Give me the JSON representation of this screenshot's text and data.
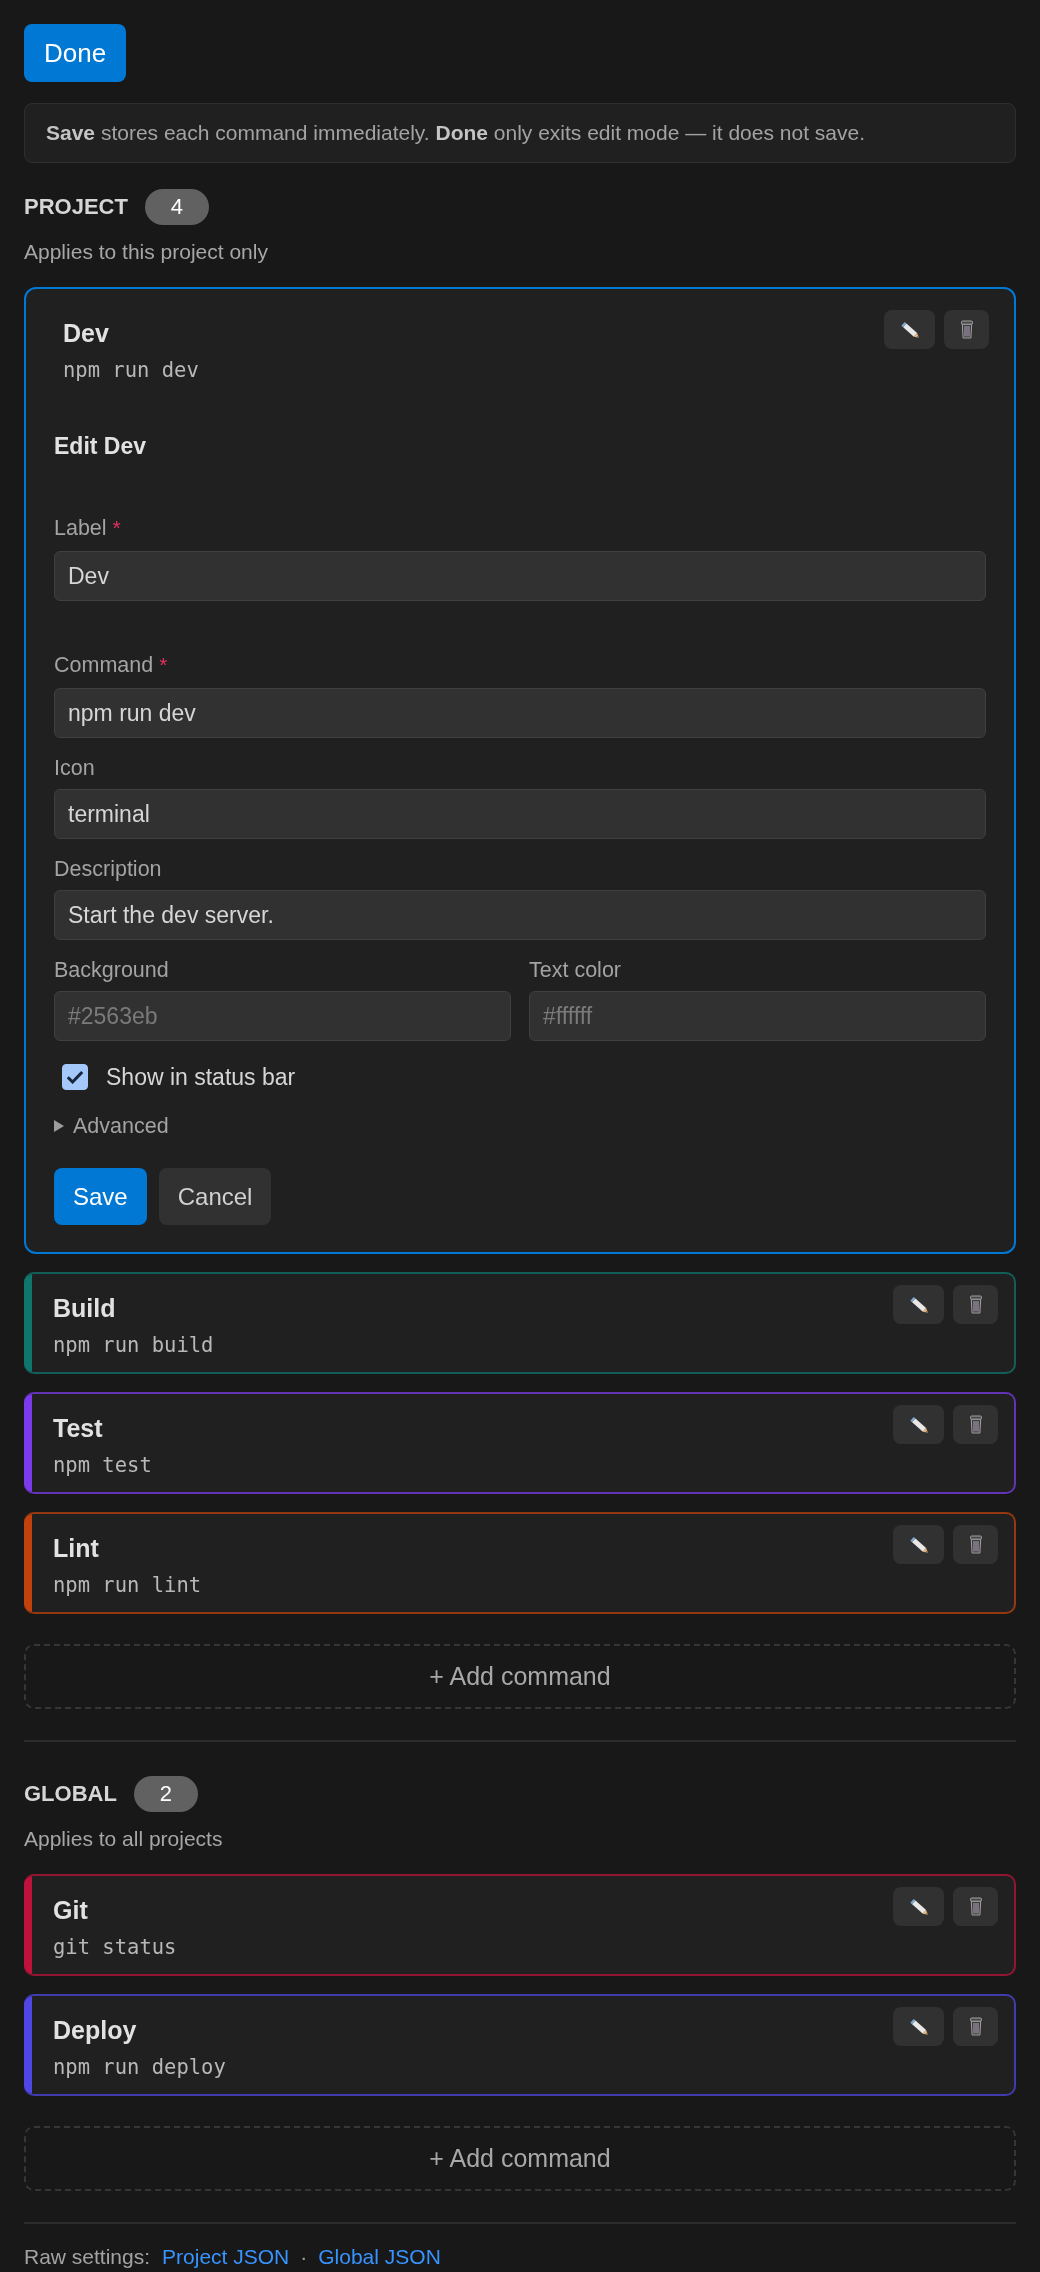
{
  "toolbar": {
    "done_button": "Done"
  },
  "notice": "**Save** stores each command immediately. **Done** only exits edit mode — it does not save.",
  "sections": [
    {
      "title": "PROJECT",
      "count": "4",
      "subtitle": "Applies to this project only",
      "commands": [
        {
          "label": "Dev",
          "command": "npm run dev",
          "editing": true,
          "editor": {
            "heading": "Edit Dev",
            "fields": [
              {
                "kind": "text",
                "label": "Label",
                "required_mark": "*",
                "value": "Dev"
              },
              {
                "kind": "text",
                "label": "Command",
                "required_mark": "*",
                "value": "npm run dev"
              },
              {
                "kind": "text",
                "label": "Icon",
                "value": "terminal"
              },
              {
                "kind": "text",
                "label": "Description",
                "value": "Start the dev server."
              },
              {
                "kind": "color",
                "label": "Background",
                "placeholder": "#2563eb"
              },
              {
                "kind": "color",
                "label": "Text color",
                "placeholder": "#ffffff"
              }
            ],
            "checkbox": {
              "label": "Show in status bar",
              "checked": true
            },
            "advanced": {
              "label": "Advanced",
              "expanded": false
            },
            "buttons": [
              {
                "label": "Save",
                "kind": "primary"
              },
              {
                "label": "Cancel",
                "kind": "secondary"
              }
            ]
          }
        },
        {
          "label": "Build",
          "command": "npm run build",
          "editing": false,
          "color": "#0f766e"
        },
        {
          "label": "Test",
          "command": "npm test",
          "editing": false,
          "color": "#7c3aed"
        },
        {
          "label": "Lint",
          "command": "npm run lint",
          "editing": false,
          "color": "#c2410c"
        }
      ],
      "add_button": "+ Add command"
    },
    {
      "title": "GLOBAL",
      "count": "2",
      "subtitle": "Applies to all projects",
      "commands": [
        {
          "label": "Git",
          "command": "git status",
          "editing": false,
          "color": "#be123c"
        },
        {
          "label": "Deploy",
          "command": "npm run deploy",
          "editing": false,
          "color": "#4f46e5"
        }
      ],
      "add_button": "+ Add command"
    }
  ],
  "footer": {
    "label": "Raw settings:",
    "links": [
      "Project JSON",
      "Global JSON"
    ],
    "separator": "·"
  }
}
